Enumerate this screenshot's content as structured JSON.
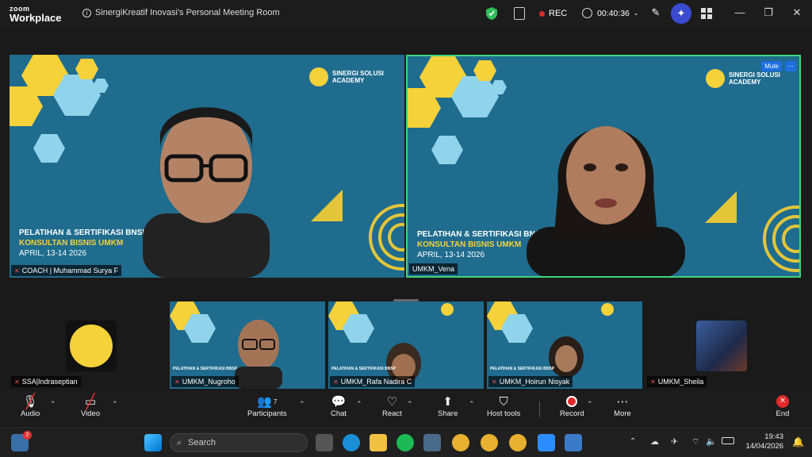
{
  "app": {
    "brand_top": "zoom",
    "brand_bottom": "Workplace",
    "meeting_title": "SinergiKreatif Inovasi's Personal Meeting Room"
  },
  "status": {
    "rec_label": "REC",
    "elapsed": "00:40:36"
  },
  "window_controls": {
    "minimize": "—",
    "maximize": "❐",
    "close": "✕"
  },
  "colors": {
    "accent_green": "#3fd47a",
    "tile_blue": "#1f6c8e",
    "banner_yellow": "#f5d13a",
    "record_red": "#e02a2a"
  },
  "banner": {
    "line1": "PELATIHAN & SERTIFIKASI BNSP",
    "line2": "KONSULTAN BISNIS UMKM",
    "line3": "APRIL, 13-14  2026",
    "academy": "SINERGI SOLUSI\nACADEMY"
  },
  "main_tiles": [
    {
      "name": "COACH | Muhammad Surya F",
      "muted": true
    },
    {
      "name": "UMKM_Vena",
      "muted": false,
      "mute_button": "Mute",
      "more_button": "···"
    }
  ],
  "thumbnails": [
    {
      "name": "SSA|Indraseptian",
      "muted": true
    },
    {
      "name": "UMKM_Nugroho",
      "muted": true
    },
    {
      "name": "UMKM_Rafa Nadira C",
      "muted": true
    },
    {
      "name": "UMKM_Hoirun Nisyak",
      "muted": true
    },
    {
      "name": "UMKM_Sheila",
      "muted": true
    }
  ],
  "toolbar": {
    "audio": "Audio",
    "video": "Video",
    "participants": "Participants",
    "participants_count": "7",
    "chat": "Chat",
    "react": "React",
    "share": "Share",
    "host_tools": "Host tools",
    "record": "Record",
    "more": "More",
    "end": "End"
  },
  "taskbar": {
    "search_placeholder": "Search",
    "weather_badge": "2",
    "time": "19:43",
    "date": "14/04/2026"
  }
}
